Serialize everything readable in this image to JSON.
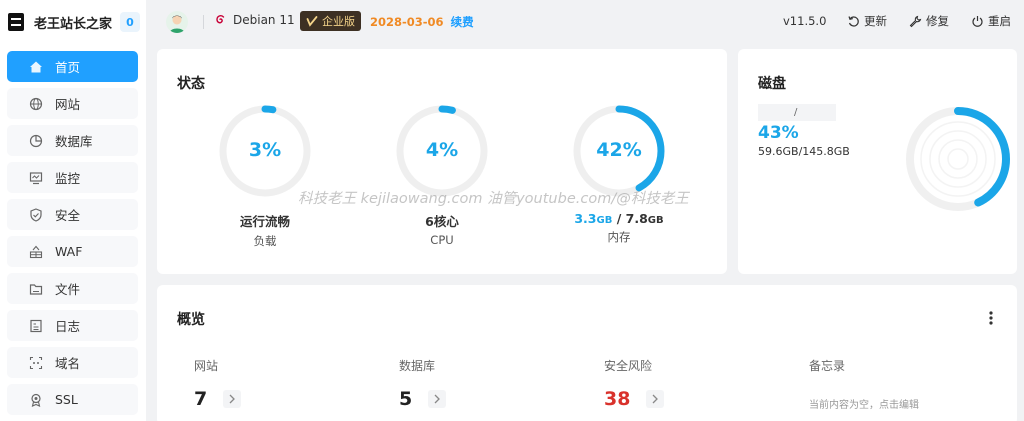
{
  "brand": {
    "name": "老王站长之家",
    "badge": "0"
  },
  "nav": {
    "items": [
      {
        "label": "首页",
        "icon": "home-icon",
        "active": true
      },
      {
        "label": "网站",
        "icon": "globe-icon"
      },
      {
        "label": "数据库",
        "icon": "database-icon"
      },
      {
        "label": "监控",
        "icon": "monitor-icon"
      },
      {
        "label": "安全",
        "icon": "shield-icon"
      },
      {
        "label": "WAF",
        "icon": "waf-icon"
      },
      {
        "label": "文件",
        "icon": "folder-icon"
      },
      {
        "label": "日志",
        "icon": "log-icon"
      },
      {
        "label": "域名",
        "icon": "domain-icon"
      },
      {
        "label": "SSL",
        "icon": "ssl-icon"
      }
    ]
  },
  "topbar": {
    "os": "Debian 11",
    "edition": "企业版",
    "expire_date": "2028-03-06",
    "renew": "续费",
    "version": "v11.5.0",
    "update": "更新",
    "repair": "修复",
    "restart": "重启"
  },
  "status": {
    "title": "状态",
    "load": {
      "percent": 3,
      "percent_text": "3%",
      "title": "运行流畅",
      "sub": "负载"
    },
    "cpu": {
      "percent": 4,
      "percent_text": "4%",
      "title": "6核心",
      "sub": "CPU"
    },
    "memory": {
      "percent": 42,
      "percent_text": "42%",
      "used": "3.3",
      "used_unit": "GB",
      "slash": "/",
      "total": "7.8",
      "total_unit": "GB",
      "sub": "内存"
    }
  },
  "disk": {
    "title": "磁盘",
    "path": "/",
    "percent": 43,
    "percent_text": "43%",
    "size": "59.6GB/145.8GB"
  },
  "overview": {
    "title": "概览",
    "items": [
      {
        "label": "网站",
        "value": "7"
      },
      {
        "label": "数据库",
        "value": "5"
      },
      {
        "label": "安全风险",
        "value": "38"
      }
    ],
    "memo": {
      "label": "备忘录",
      "empty": "当前内容为空，点击编辑"
    }
  },
  "watermark": "科技老王 kejilaowang.com 油管youtube.com/@科技老王",
  "colors": {
    "accent": "#20a0ff",
    "gauge": "#1ba6e8",
    "danger": "#d9322c",
    "expire": "#f08a24"
  }
}
